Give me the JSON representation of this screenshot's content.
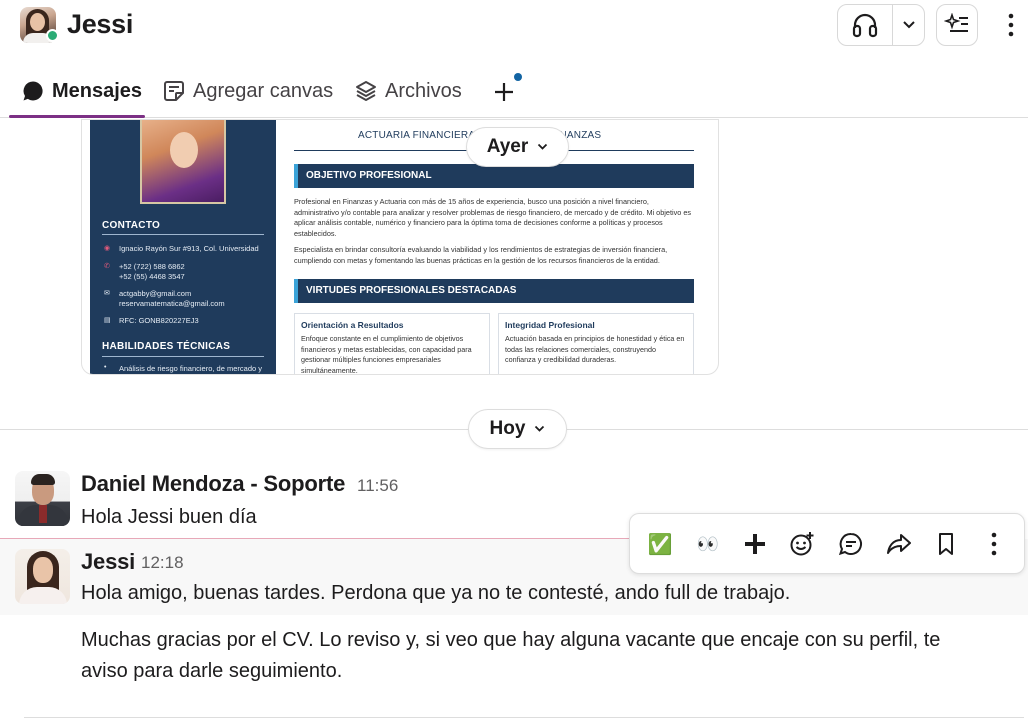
{
  "header": {
    "title": "Jessi",
    "presence": "active",
    "huddle_icon": "headphones-icon",
    "ai_icon": "sparkle-list-icon",
    "more_icon": "kebab-icon"
  },
  "tabs": [
    {
      "label": "Mensajes",
      "icon": "message-bubble-icon",
      "active": true
    },
    {
      "label": "Agregar canvas",
      "icon": "canvas-icon",
      "active": false
    },
    {
      "label": "Archivos",
      "icon": "layers-icon",
      "active": false
    }
  ],
  "cv": {
    "subtitle": "ACTUARIA FINANCIERA | EXPERTA EN FINANZAS",
    "contact_title": "CONTACTO",
    "contact": [
      {
        "icon": "pin-icon",
        "text": "Ignacio Rayón Sur #913, Col. Universidad"
      },
      {
        "icon": "phone-icon",
        "text": "+52 (722) 588 6862"
      },
      {
        "icon": "phone-icon",
        "text": "+52 (55) 4468 3547"
      },
      {
        "icon": "mail-icon",
        "text": "actgabby@gmail.com"
      },
      {
        "icon": "mail-icon",
        "text": "reservamatematica@gmail.com"
      },
      {
        "icon": "doc-icon",
        "text": "RFC: GONB820227EJ3"
      }
    ],
    "skills_title": "HABILIDADES TÉCNICAS",
    "skills_first": "Análisis de riesgo financiero, de mercado y",
    "objective_title": "OBJETIVO PROFESIONAL",
    "objective_p1": "Profesional en Finanzas y Actuaria con más de 15 años de experiencia, busco una posición a nivel financiero, administrativo y/o contable para analizar y resolver problemas de riesgo financiero, de mercado y de crédito. Mi objetivo es aplicar análisis contable, numérico y financiero para la óptima toma de decisiones conforme a políticas y procesos establecidos.",
    "objective_p2": "Especialista en brindar consultoría evaluando la viabilidad y los rendimientos de estrategias de inversión financiera, cumpliendo con metas y fomentando las buenas prácticas en la gestión de los recursos financieros de la entidad.",
    "virtues_title": "VIRTUDES PROFESIONALES DESTACADAS",
    "virtues": [
      {
        "title": "Orientación a Resultados",
        "body": "Enfoque constante en el cumplimiento de objetivos financieros y metas establecidas, con capacidad para gestionar múltiples funciones empresariales simultáneamente."
      },
      {
        "title": "Integridad Profesional",
        "body": "Actuación basada en principios de honestidad y ética en todas las relaciones comerciales, construyendo confianza y credibilidad duraderas."
      }
    ]
  },
  "dates": {
    "yesterday": "Ayer",
    "today": "Hoy"
  },
  "messages": [
    {
      "author": "Daniel Mendoza - Soporte",
      "time": "11:56",
      "lines": [
        "Hola Jessi buen día"
      ]
    },
    {
      "author": "Jessi",
      "time": "12:18",
      "lines": [
        "Hola amigo, buenas tardes. Perdona que ya no te contesté, ando full de trabajo.",
        "Muchas gracias por el CV. Lo reviso y, si veo que hay alguna vacante que encaje con su perfil, te",
        "aviso para darle seguimiento."
      ]
    }
  ],
  "toolbar": {
    "check": "✅",
    "eyes": "👀",
    "icons": [
      "check-mark-emoji-icon",
      "eyes-emoji-icon",
      "plus-icon",
      "add-reaction-icon",
      "reply-thread-icon",
      "forward-icon",
      "bookmark-icon",
      "more-actions-icon"
    ]
  },
  "colors": {
    "accent": "#7c3085",
    "presence": "#2bac76",
    "notification": "#1264a3",
    "cv_navy": "#1f3b5c"
  }
}
